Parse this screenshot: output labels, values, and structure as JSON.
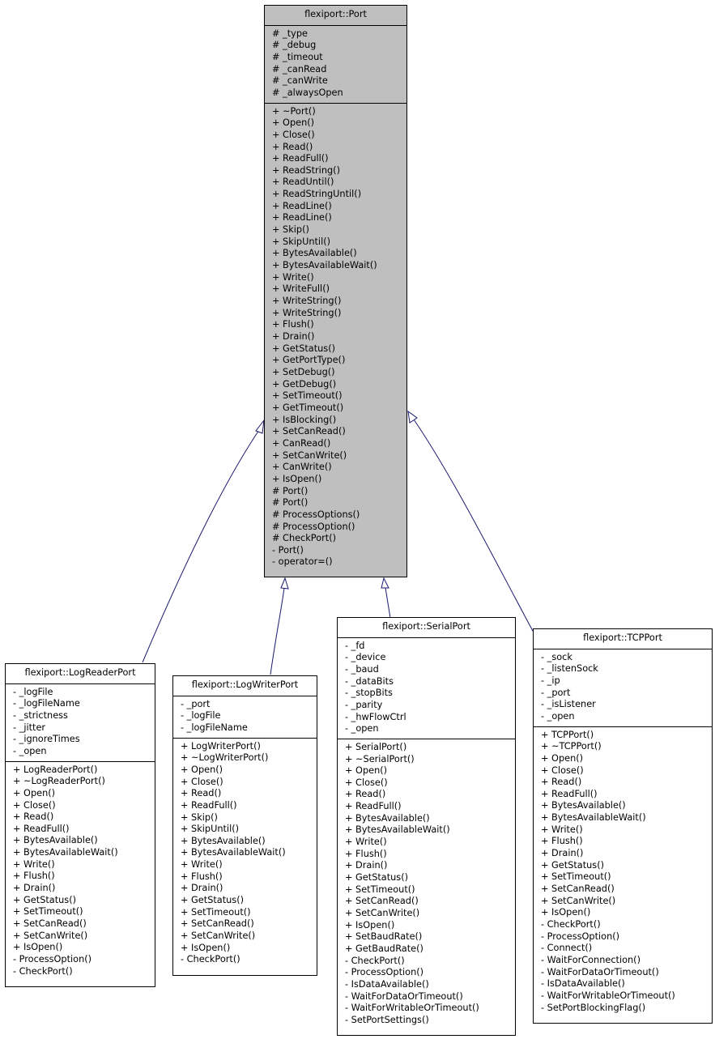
{
  "diagram": {
    "type": "uml-class-inheritance",
    "edge_color": "#191970",
    "base_fill": "#bfbfbf",
    "classes": {
      "port": {
        "name": "flexiport::Port",
        "attributes": [
          "# _type",
          "# _debug",
          "# _timeout",
          "# _canRead",
          "# _canWrite",
          "# _alwaysOpen"
        ],
        "operations": [
          "+ ~Port()",
          "+ Open()",
          "+ Close()",
          "+ Read()",
          "+ ReadFull()",
          "+ ReadString()",
          "+ ReadUntil()",
          "+ ReadStringUntil()",
          "+ ReadLine()",
          "+ ReadLine()",
          "+ Skip()",
          "+ SkipUntil()",
          "+ BytesAvailable()",
          "+ BytesAvailableWait()",
          "+ Write()",
          "+ WriteFull()",
          "+ WriteString()",
          "+ WriteString()",
          "+ Flush()",
          "+ Drain()",
          "+ GetStatus()",
          "+ GetPortType()",
          "+ SetDebug()",
          "+ GetDebug()",
          "+ SetTimeout()",
          "+ GetTimeout()",
          "+ IsBlocking()",
          "+ SetCanRead()",
          "+ CanRead()",
          "+ SetCanWrite()",
          "+ CanWrite()",
          "+ IsOpen()",
          "# Port()",
          "# Port()",
          "# ProcessOptions()",
          "# ProcessOption()",
          "# CheckPort()",
          "- Port()",
          "- operator=()"
        ]
      },
      "logreader": {
        "name": "flexiport::LogReaderPort",
        "attributes": [
          "- _logFile",
          "- _logFileName",
          "- _strictness",
          "- _jitter",
          "- _ignoreTimes",
          "- _open"
        ],
        "operations": [
          "+ LogReaderPort()",
          "+ ~LogReaderPort()",
          "+ Open()",
          "+ Close()",
          "+ Read()",
          "+ ReadFull()",
          "+ BytesAvailable()",
          "+ BytesAvailableWait()",
          "+ Write()",
          "+ Flush()",
          "+ Drain()",
          "+ GetStatus()",
          "+ SetTimeout()",
          "+ SetCanRead()",
          "+ SetCanWrite()",
          "+ IsOpen()",
          "- ProcessOption()",
          "- CheckPort()"
        ]
      },
      "logwriter": {
        "name": "flexiport::LogWriterPort",
        "attributes": [
          "- _port",
          "- _logFile",
          "- _logFileName"
        ],
        "operations": [
          "+ LogWriterPort()",
          "+ ~LogWriterPort()",
          "+ Open()",
          "+ Close()",
          "+ Read()",
          "+ ReadFull()",
          "+ Skip()",
          "+ SkipUntil()",
          "+ BytesAvailable()",
          "+ BytesAvailableWait()",
          "+ Write()",
          "+ Flush()",
          "+ Drain()",
          "+ GetStatus()",
          "+ SetTimeout()",
          "+ SetCanRead()",
          "+ SetCanWrite()",
          "+ IsOpen()",
          "- CheckPort()"
        ]
      },
      "serial": {
        "name": "flexiport::SerialPort",
        "attributes": [
          "- _fd",
          "- _device",
          "- _baud",
          "- _dataBits",
          "- _stopBits",
          "- _parity",
          "- _hwFlowCtrl",
          "- _open"
        ],
        "operations": [
          "+ SerialPort()",
          "+ ~SerialPort()",
          "+ Open()",
          "+ Close()",
          "+ Read()",
          "+ ReadFull()",
          "+ BytesAvailable()",
          "+ BytesAvailableWait()",
          "+ Write()",
          "+ Flush()",
          "+ Drain()",
          "+ GetStatus()",
          "+ SetTimeout()",
          "+ SetCanRead()",
          "+ SetCanWrite()",
          "+ IsOpen()",
          "+ SetBaudRate()",
          "+ GetBaudRate()",
          "- CheckPort()",
          "- ProcessOption()",
          "- IsDataAvailable()",
          "- WaitForDataOrTimeout()",
          "- WaitForWritableOrTimeout()",
          "- SetPortSettings()"
        ]
      },
      "tcp": {
        "name": "flexiport::TCPPort",
        "attributes": [
          "- _sock",
          "- _listenSock",
          "- _ip",
          "- _port",
          "- _isListener",
          "- _open"
        ],
        "operations": [
          "+ TCPPort()",
          "+ ~TCPPort()",
          "+ Open()",
          "+ Close()",
          "+ Read()",
          "+ ReadFull()",
          "+ BytesAvailable()",
          "+ BytesAvailableWait()",
          "+ Write()",
          "+ Flush()",
          "+ Drain()",
          "+ GetStatus()",
          "+ SetTimeout()",
          "+ SetCanRead()",
          "+ SetCanWrite()",
          "+ IsOpen()",
          "- CheckPort()",
          "- ProcessOption()",
          "- Connect()",
          "- WaitForConnection()",
          "- WaitForDataOrTimeout()",
          "- IsDataAvailable()",
          "- WaitForWritableOrTimeout()",
          "- SetPortBlockingFlag()"
        ]
      }
    },
    "inheritance": [
      {
        "child": "flexiport::LogReaderPort",
        "parent": "flexiport::Port"
      },
      {
        "child": "flexiport::LogWriterPort",
        "parent": "flexiport::Port"
      },
      {
        "child": "flexiport::SerialPort",
        "parent": "flexiport::Port"
      },
      {
        "child": "flexiport::TCPPort",
        "parent": "flexiport::Port"
      }
    ]
  }
}
